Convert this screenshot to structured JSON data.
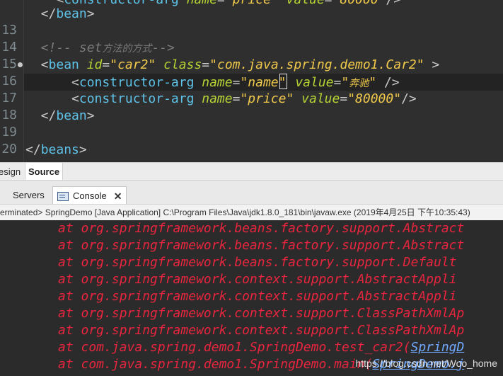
{
  "editor": {
    "lines": [
      {
        "no": "",
        "parts": [
          {
            "t": "    <",
            "c": "punc"
          },
          {
            "t": "constructor-arg",
            "c": "tag"
          },
          {
            "t": " name",
            "c": "attr"
          },
          {
            "t": "=",
            "c": "punc"
          },
          {
            "t": "\"price\"",
            "c": "str"
          },
          {
            "t": " value",
            "c": "attr"
          },
          {
            "t": "=",
            "c": "punc"
          },
          {
            "t": "\"80000\"",
            "c": "str"
          },
          {
            "t": "/>",
            "c": "punc"
          }
        ]
      },
      {
        "no": "",
        "parts": [
          {
            "t": "  </",
            "c": "punc"
          },
          {
            "t": "bean",
            "c": "tag"
          },
          {
            "t": ">",
            "c": "punc"
          }
        ]
      },
      {
        "no": "13",
        "parts": []
      },
      {
        "no": "14",
        "parts": [
          {
            "t": "  <!-- set",
            "c": "comment"
          },
          {
            "t": "方法的方式",
            "c": "comment cjk"
          },
          {
            "t": "-->",
            "c": "comment"
          }
        ]
      },
      {
        "no": "15",
        "parts": [
          {
            "t": "  <",
            "c": "punc"
          },
          {
            "t": "bean",
            "c": "tag"
          },
          {
            "t": " id",
            "c": "attr"
          },
          {
            "t": "=",
            "c": "punc"
          },
          {
            "t": "\"car2\"",
            "c": "str"
          },
          {
            "t": " class",
            "c": "attr"
          },
          {
            "t": "=",
            "c": "punc"
          },
          {
            "t": "\"com.java.spring.demo1.Car2\"",
            "c": "str"
          },
          {
            "t": " >",
            "c": "punc"
          }
        ]
      },
      {
        "no": "16",
        "parts": [
          {
            "t": "      <",
            "c": "punc"
          },
          {
            "t": "constructor-arg",
            "c": "tag"
          },
          {
            "t": " name",
            "c": "attr"
          },
          {
            "t": "=",
            "c": "punc"
          },
          {
            "t": "\"name\"",
            "c": "str"
          },
          {
            "t": "",
            "c": "caret"
          },
          {
            "t": " value",
            "c": "attr"
          },
          {
            "t": "=",
            "c": "punc"
          },
          {
            "t": "\"",
            "c": "str"
          },
          {
            "t": "奔驰",
            "c": "str cjk"
          },
          {
            "t": "\"",
            "c": "str"
          },
          {
            "t": " />",
            "c": "punc"
          }
        ]
      },
      {
        "no": "17",
        "parts": [
          {
            "t": "      <",
            "c": "punc"
          },
          {
            "t": "constructor-arg",
            "c": "tag"
          },
          {
            "t": " name",
            "c": "attr"
          },
          {
            "t": "=",
            "c": "punc"
          },
          {
            "t": "\"price\"",
            "c": "str"
          },
          {
            "t": " value",
            "c": "attr"
          },
          {
            "t": "=",
            "c": "punc"
          },
          {
            "t": "\"80000\"",
            "c": "str"
          },
          {
            "t": "/>",
            "c": "punc"
          }
        ]
      },
      {
        "no": "18",
        "parts": [
          {
            "t": "  </",
            "c": "punc"
          },
          {
            "t": "bean",
            "c": "tag"
          },
          {
            "t": ">",
            "c": "punc"
          }
        ]
      },
      {
        "no": "19",
        "parts": []
      },
      {
        "no": "20",
        "parts": [
          {
            "t": "</",
            "c": "punc"
          },
          {
            "t": "beans",
            "c": "tag"
          },
          {
            "t": ">",
            "c": "punc"
          }
        ]
      }
    ]
  },
  "modebar": {
    "design_label": "esign",
    "source_label": "Source"
  },
  "views": {
    "servers_label": "Servers",
    "console_label": "Console",
    "close_glyph": "✕"
  },
  "status": {
    "text": "erminated> SpringDemo [Java Application] C:\\Program Files\\Java\\jdk1.8.0_181\\bin\\javaw.exe (2019年4月25日 下午10:35:43)"
  },
  "console": {
    "lines": [
      {
        "text": "at org.springframework.beans.factory.support.Abstract"
      },
      {
        "text": "at org.springframework.beans.factory.support.Abstract"
      },
      {
        "text": "at org.springframework.beans.factory.support.Default"
      },
      {
        "text": "at org.springframework.context.support.AbstractAppli"
      },
      {
        "text": "at org.springframework.context.support.AbstractAppli"
      },
      {
        "text": "at org.springframework.context.support.ClassPathXmlAp"
      },
      {
        "text": "at org.springframework.context.support.ClassPathXmlAp"
      },
      {
        "text": "at com.java.spring.demo1.SpringDemo.test_car2(",
        "link": "SpringD"
      },
      {
        "text": "at com.java.spring.demo1.SpringDemo.main(",
        "link": "SpringDemo.j"
      }
    ],
    "watermark": "https://blog.csdn.net/Woo_home"
  }
}
